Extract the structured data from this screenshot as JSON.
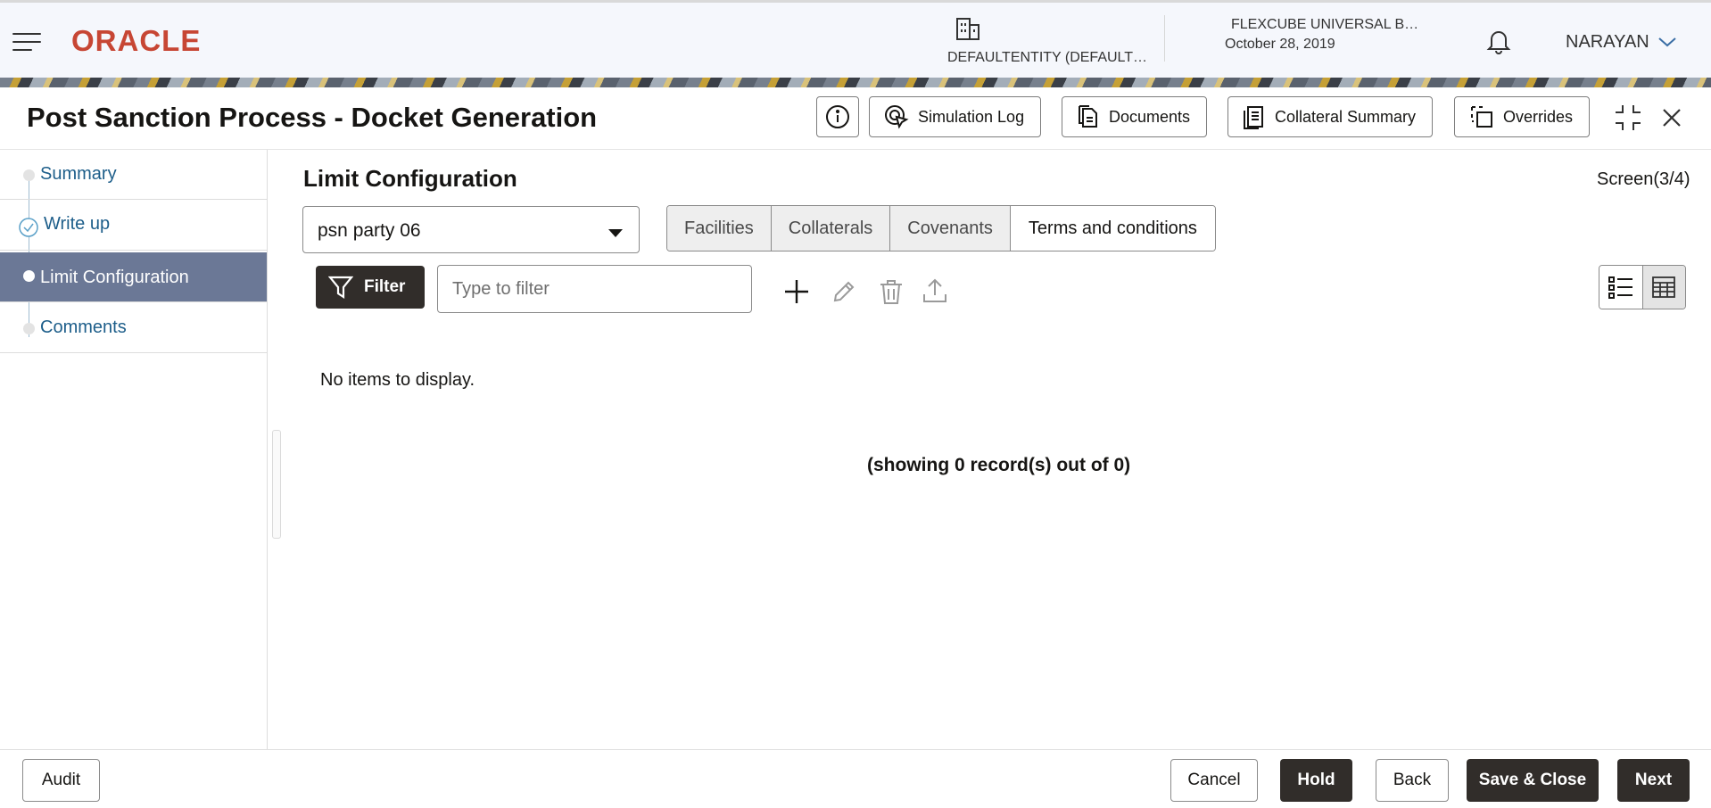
{
  "header": {
    "logo": "ORACLE",
    "entity": "DEFAULTENTITY (DEFAULT…",
    "branch": "FLEXCUBE UNIVERSAL B…",
    "date": "October 28, 2019",
    "user": "NARAYAN"
  },
  "page": {
    "title": "Post Sanction Process - Docket Generation",
    "actions": {
      "simulation_log": "Simulation Log",
      "documents": "Documents",
      "collateral_summary": "Collateral Summary",
      "overrides": "Overrides"
    }
  },
  "sidebar": {
    "items": [
      {
        "label": "Summary",
        "state": "pending"
      },
      {
        "label": "Write up",
        "state": "completed"
      },
      {
        "label": "Limit Configuration",
        "state": "active"
      },
      {
        "label": "Comments",
        "state": "pending"
      }
    ]
  },
  "main": {
    "section_title": "Limit Configuration",
    "screen_indicator": "Screen(3/4)",
    "party_select_value": "psn party 06",
    "tabs": [
      {
        "label": "Facilities",
        "selected": false
      },
      {
        "label": "Collaterals",
        "selected": false
      },
      {
        "label": "Covenants",
        "selected": false
      },
      {
        "label": "Terms and conditions",
        "selected": true
      }
    ],
    "filter_label": "Filter",
    "filter_placeholder": "Type to filter",
    "empty_message": "No items to display.",
    "record_count": "(showing 0 record(s) out of 0)"
  },
  "footer": {
    "audit": "Audit",
    "cancel": "Cancel",
    "hold": "Hold",
    "back": "Back",
    "save_close": "Save & Close",
    "next": "Next"
  },
  "colors": {
    "brand": "#c74634",
    "primary_dark": "#312d2a",
    "nav_active": "#6b7896",
    "link": "#1d5e8a"
  }
}
